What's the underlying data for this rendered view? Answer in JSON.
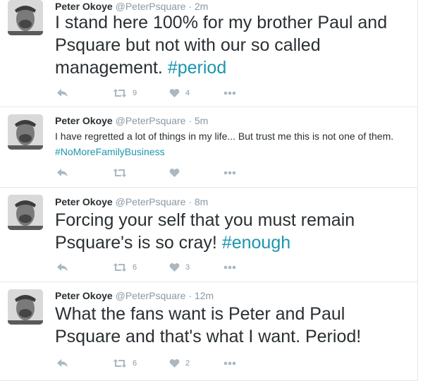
{
  "tweets": [
    {
      "name": "Peter Okoye",
      "handle": "@PeterPsquare",
      "separator": "·",
      "time": "2m",
      "text": "I stand here 100% for my brother Paul and Psquare but not with our so called management.",
      "hashtag": "#period",
      "retweets": "9",
      "likes": "4"
    },
    {
      "name": "Peter Okoye",
      "handle": "@PeterPsquare",
      "separator": "·",
      "time": "5m",
      "text": "I have regretted a lot of things in my life... But trust me this is not one of them.",
      "hashtag": "#NoMoreFamilyBusiness",
      "retweets": "",
      "likes": ""
    },
    {
      "name": "Peter Okoye",
      "handle": "@PeterPsquare",
      "separator": "·",
      "time": "8m",
      "text": "Forcing your self that you must remain Psquare's is so cray!",
      "hashtag": "#enough",
      "retweets": "6",
      "likes": "3"
    },
    {
      "name": "Peter Okoye",
      "handle": "@PeterPsquare",
      "separator": "·",
      "time": "12m",
      "text": "What the fans want is Peter and Paul Psquare and that's what I want. Period!",
      "hashtag": "",
      "retweets": "6",
      "likes": "2"
    }
  ],
  "icons": {
    "reply": "reply-icon",
    "retweet": "retweet-icon",
    "like": "heart-icon",
    "more": "more-icon"
  },
  "colors": {
    "hashtag": "#1b95b0",
    "meta": "#8899a6",
    "icon": "#aab8c2",
    "divider": "#e1e8ed"
  }
}
